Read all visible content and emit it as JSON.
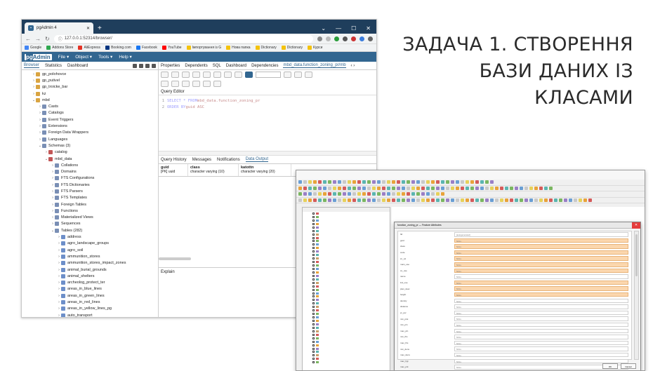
{
  "slide_title": {
    "line1": "ЗАДАЧА 1. СТВОРЕННЯ",
    "line2": "БАЗИ ДАНИХ ІЗ",
    "line3": "КЛАСАМИ"
  },
  "browser": {
    "tab_title": "pgAdmin 4",
    "url": "127.0.0.1:52314/browser/",
    "bookmarks": [
      "Google",
      "Addons Store",
      "AliExpress",
      "Booking.com",
      "Facebook",
      "YouTube",
      "Імпортування із G",
      "Нова папка",
      "Dictionary",
      "Dictionary",
      "Курси"
    ]
  },
  "pgadmin": {
    "logo_pg": "pg",
    "logo_admin": "Admin",
    "menu": [
      "File ▾",
      "Object ▾",
      "Tools ▾",
      "Help ▾"
    ],
    "left_tabs": [
      "Browser",
      "Statistics",
      "Dashboard"
    ],
    "right_tabs": [
      "Properties",
      "Dependents",
      "SQL",
      "Dashboard",
      "Dependencies",
      "mbd_data.function_zoning_pr/mb"
    ],
    "tree": [
      {
        "label": "gp_polohovce",
        "depth": 2,
        "arrow": "›"
      },
      {
        "label": "gp_putivel",
        "depth": 2,
        "arrow": "›"
      },
      {
        "label": "gp_troicke_bar",
        "depth": 2,
        "arrow": "›"
      },
      {
        "label": "kz",
        "depth": 2,
        "arrow": "›"
      },
      {
        "label": "mbd",
        "depth": 2,
        "arrow": "⌄"
      },
      {
        "label": "Casts",
        "depth": 3,
        "arrow": "›"
      },
      {
        "label": "Catalogs",
        "depth": 3,
        "arrow": "›"
      },
      {
        "label": "Event Triggers",
        "depth": 3,
        "arrow": "›"
      },
      {
        "label": "Extensions",
        "depth": 3,
        "arrow": "›"
      },
      {
        "label": "Foreign Data Wrappers",
        "depth": 3,
        "arrow": "›"
      },
      {
        "label": "Languages",
        "depth": 3,
        "arrow": "›"
      },
      {
        "label": "Schemas (3)",
        "depth": 3,
        "arrow": "⌄"
      },
      {
        "label": "catalog",
        "depth": 4,
        "arrow": "›"
      },
      {
        "label": "mbd_data",
        "depth": 4,
        "arrow": "⌄"
      },
      {
        "label": "Collations",
        "depth": 5,
        "arrow": "›"
      },
      {
        "label": "Domains",
        "depth": 5,
        "arrow": "›"
      },
      {
        "label": "FTS Configurations",
        "depth": 5,
        "arrow": "›"
      },
      {
        "label": "FTS Dictionaries",
        "depth": 5,
        "arrow": "›"
      },
      {
        "label": "FTS Parsers",
        "depth": 5,
        "arrow": "›"
      },
      {
        "label": "FTS Templates",
        "depth": 5,
        "arrow": "›"
      },
      {
        "label": "Foreign Tables",
        "depth": 5,
        "arrow": "›"
      },
      {
        "label": "Functions",
        "depth": 5,
        "arrow": "›"
      },
      {
        "label": "Materialized Views",
        "depth": 5,
        "arrow": "›"
      },
      {
        "label": "Sequences",
        "depth": 5,
        "arrow": "›"
      },
      {
        "label": "Tables (282)",
        "depth": 5,
        "arrow": "⌄"
      },
      {
        "label": "address",
        "depth": 6,
        "arrow": "›"
      },
      {
        "label": "agro_landscape_groups",
        "depth": 6,
        "arrow": "›"
      },
      {
        "label": "agro_soil",
        "depth": 6,
        "arrow": "›"
      },
      {
        "label": "ammunition_stores",
        "depth": 6,
        "arrow": "›"
      },
      {
        "label": "ammunition_stores_impact_zones",
        "depth": 6,
        "arrow": "›"
      },
      {
        "label": "animal_burial_grounds",
        "depth": 6,
        "arrow": "›"
      },
      {
        "label": "animal_shelters",
        "depth": 6,
        "arrow": "›"
      },
      {
        "label": "archeolog_protect_ter",
        "depth": 6,
        "arrow": "›"
      },
      {
        "label": "areas_in_blue_lines",
        "depth": 6,
        "arrow": "›"
      },
      {
        "label": "areas_in_green_lines",
        "depth": 6,
        "arrow": "›"
      },
      {
        "label": "areas_in_red_lines",
        "depth": 6,
        "arrow": "›"
      },
      {
        "label": "areas_in_yellow_lines_pg",
        "depth": 6,
        "arrow": "›"
      },
      {
        "label": "auto_transport",
        "depth": 6,
        "arrow": "›"
      }
    ],
    "query_editor_label": "Query Editor",
    "sql": {
      "line1_no": "1",
      "line1_kw": "SELECT * FROM",
      "line1_obj": " mbd_data.function_zoning_pr",
      "line2_no": "2",
      "line2_kw": "ORDER BY",
      "line2_obj": " guid ASC"
    },
    "result_tabs": [
      "Query History",
      "Messages",
      "Notifications",
      "Data Output"
    ],
    "columns": [
      {
        "name": "guid",
        "type": "[PK] uuid"
      },
      {
        "name": "class",
        "type": "character varying (10)"
      },
      {
        "name": "katottn",
        "type": "character varying (20)"
      }
    ],
    "explain_label": "Explain"
  },
  "qgis": {
    "dialog_title": "function_zoning_pr — Feature Attributes",
    "fields": [
      {
        "label": "fid",
        "value": "[autogenerated]",
        "highlight": false
      },
      {
        "label": "guid",
        "value": "NULL",
        "highlight": true
      },
      {
        "label": "class",
        "value": "NULL",
        "highlight": true
      },
      {
        "label": "code",
        "value": "NULL",
        "highlight": true
      },
      {
        "label": "zn_cd",
        "value": "NULL",
        "highlight": true
      },
      {
        "label": "main_use",
        "value": "NULL",
        "highlight": true
      },
      {
        "label": "co_use",
        "value": "NULL",
        "highlight": true
      },
      {
        "label": "name",
        "value": "NULL",
        "highlight": false
      },
      {
        "label": "lnd_use",
        "value": "NULL",
        "highlight": true
      },
      {
        "label": "plan_desc",
        "value": "NULL",
        "highlight": true
      },
      {
        "label": "height",
        "value": "NULL",
        "highlight": true
      },
      {
        "label": "density",
        "value": "NULL",
        "highlight": false
      },
      {
        "label": "distance",
        "value": "NULL",
        "highlight": false
      },
      {
        "label": "pr_per",
        "value": "NULL",
        "highlight": false
      },
      {
        "label": "min_plot",
        "value": "NULL",
        "highlight": false
      },
      {
        "label": "min_pln",
        "value": "NULL",
        "highlight": false
      },
      {
        "label": "max_pln",
        "value": "NULL",
        "highlight": false
      },
      {
        "label": "min_flrs",
        "value": "NULL",
        "highlight": false
      },
      {
        "label": "max_flrs",
        "value": "NULL",
        "highlight": false
      },
      {
        "label": "min_dens",
        "value": "NULL",
        "highlight": false
      },
      {
        "label": "max_dens",
        "value": "NULL",
        "highlight": false
      },
      {
        "label": "max_hgt",
        "value": "NULL",
        "highlight": false
      },
      {
        "label": "max_prk",
        "value": "NULL",
        "highlight": false
      },
      {
        "label": "max_code",
        "value": "NULL",
        "highlight": false
      },
      {
        "label": "fix_date",
        "value": "NULL",
        "highlight": false
      },
      {
        "label": "fix_login",
        "value": "NULL",
        "highlight": false
      }
    ],
    "ok_label": "OK",
    "cancel_label": "Cancel"
  },
  "colors": {
    "pgadmin_blue": "#326690",
    "highlight_orange": "#fbd7ae"
  }
}
